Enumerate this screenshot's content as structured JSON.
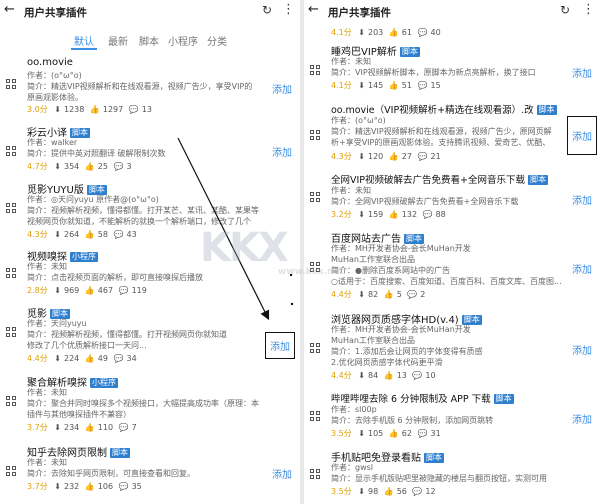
{
  "left": {
    "title": "用户共享插件",
    "tabs": [
      "默认",
      "最新",
      "脚本",
      "小程序",
      "分类"
    ],
    "items": [
      {
        "name": "oo.movie",
        "tag": "",
        "author": "作者：(o°ω°o)",
        "intro": "简介：精选VIP视频解析和在线观看源，视频广告少，享受VIP的",
        "intro2": "原画观影体验。",
        "score": "3.0分",
        "downloads": "1238",
        "likes": "1297",
        "comments": "13",
        "add": "添加"
      },
      {
        "name": "彩云小译",
        "tag": "脚本",
        "author": "作者：walker",
        "intro": "简介：提供中英对照翻译 破解限制次数",
        "intro2": "",
        "score": "4.7分",
        "downloads": "354",
        "likes": "25",
        "comments": "3",
        "add": "添加"
      },
      {
        "name": "觅影YUYU版",
        "tag": "脚本",
        "author": "作者：◎天问yuyu 原作者@(o°ω°o)",
        "intro": "简介：视频解析视频，懂得都懂。打开某芒、某讯、某酷、某果等",
        "intro2": "视频网页你就知道，不能解析的就换一个解析端口，修改了几个",
        "score": "4.3分",
        "downloads": "264",
        "likes": "58",
        "comments": "43",
        "add": "添加"
      },
      {
        "name": "视频嗅探",
        "tag": "小程序",
        "author": "作者：未知",
        "intro": "简介：点击视频页面的解析，即可直接嗅探后播放",
        "intro2": "",
        "score": "2.8分",
        "downloads": "969",
        "likes": "467",
        "comments": "119",
        "add": "添加"
      },
      {
        "name": "觅影",
        "tag": "脚本",
        "author": "作者：天问yuyu",
        "intro": "简介：视频解析视频，懂得都懂。打开视频网页你就知道",
        "intro2": "修改了几个优质解析接口一天问...",
        "score": "4.4分",
        "downloads": "224",
        "likes": "49",
        "comments": "34",
        "add": "添加"
      },
      {
        "name": "聚合解析嗅探",
        "tag": "小程序",
        "author": "作者：未知",
        "intro": "简介：聚合并同时嗅探多个视频接口，大幅提高成功率（原理：本",
        "intro2": "插件与其他嗅探插件不兼容）",
        "score": "3.7分",
        "downloads": "234",
        "likes": "110",
        "comments": "7",
        "add": "添加"
      },
      {
        "name": "知乎去除网页限制",
        "tag": "脚本",
        "author": "作者：未知",
        "intro": "简介：去除知乎网页限制，可直接查看和回复。",
        "intro2": "",
        "score": "3.7分",
        "downloads": "232",
        "likes": "106",
        "comments": "35",
        "add": "添加"
      }
    ]
  },
  "right": {
    "title": "用户共享插件",
    "top_stats": {
      "score": "4.1分",
      "downloads": "203",
      "likes": "61",
      "comments": "40"
    },
    "items": [
      {
        "name": "睡鸡巴VIP解析",
        "tag": "脚本",
        "author": "作者：未知",
        "intro": "简介：VIP视频解析脚本，原脚本为新点亮解析，换了接口",
        "intro2": "",
        "intro3": "",
        "score": "4.1分",
        "downloads": "145",
        "likes": "51",
        "comments": "15",
        "add": "添加"
      },
      {
        "name": "oo.movie（VIP视频解析+精选在线观看源）.改",
        "tag": "脚本",
        "author": "作者：(o°ω°o)",
        "intro": "简介：精选VIP视频解析和在线观看源，视频广告少，原网页解",
        "intro2": "析+享受VIP的原画观影体验。支持腾讯视频、爱奇艺、优酷、",
        "intro3": "",
        "score": "4.3分",
        "downloads": "120",
        "likes": "27",
        "comments": "21",
        "add": "添加"
      },
      {
        "name": "全网VIP视频破解去广告免费看+全网音乐下载",
        "tag": "脚本",
        "author": "作者：未知",
        "intro": "简介：全网VIP视频破解去广告免费看+全网音乐下载",
        "intro2": "",
        "intro3": "",
        "score": "3.2分",
        "downloads": "159",
        "likes": "132",
        "comments": "88",
        "add": "添加"
      },
      {
        "name": "百度网站去广告",
        "tag": "脚本",
        "author": "作者：MH开发者协会-会长MuHan开发",
        "intro": "MuHan工作室联合出品",
        "intro2": "简介：●删除百度系网站中的广告",
        "intro3": "○适用于：百度搜索、百度知道、百度百科、百度文库、百度图...",
        "score": "4.4分",
        "downloads": "82",
        "likes": "5",
        "comments": "2",
        "add": "添加"
      },
      {
        "name": "浏览器网页质感字体HD(v.4)",
        "tag": "脚本",
        "author": "作者：MH开发者协会-会长MuHan开发",
        "intro": "MuHan工作室联合出品",
        "intro2": "简介：1.添加后会让网页的字体变得有质感",
        "intro3": "2.优化网页质感字体代码更平滑",
        "score": "4.4分",
        "downloads": "84",
        "likes": "13",
        "comments": "10",
        "add": "添加"
      },
      {
        "name": "哔哩哔哩去除 6 分钟限制及 APP 下载",
        "tag": "脚本",
        "author": "作者：sl00p",
        "intro": "简介：去除手机版 6 分钟限制，添加网页跳转",
        "intro2": "",
        "intro3": "",
        "score": "3.5分",
        "downloads": "105",
        "likes": "62",
        "comments": "31",
        "add": "添加"
      },
      {
        "name": "手机贴吧免登录看贴",
        "tag": "脚本",
        "author": "作者：gwsl",
        "intro": "简介：显示手机版贴吧里被隐藏的楼层与翻页按钮，实测可用",
        "intro2": "",
        "intro3": "",
        "score": "3.5分",
        "downloads": "98",
        "likes": "56",
        "comments": "12",
        "add": "添加"
      }
    ]
  },
  "watermark": {
    "text": "KKX",
    "sub": "www.kkx.net"
  },
  "colors": {
    "accent": "#3a8ee6",
    "tag": "#2f7fcf",
    "score": "#e0a000"
  }
}
